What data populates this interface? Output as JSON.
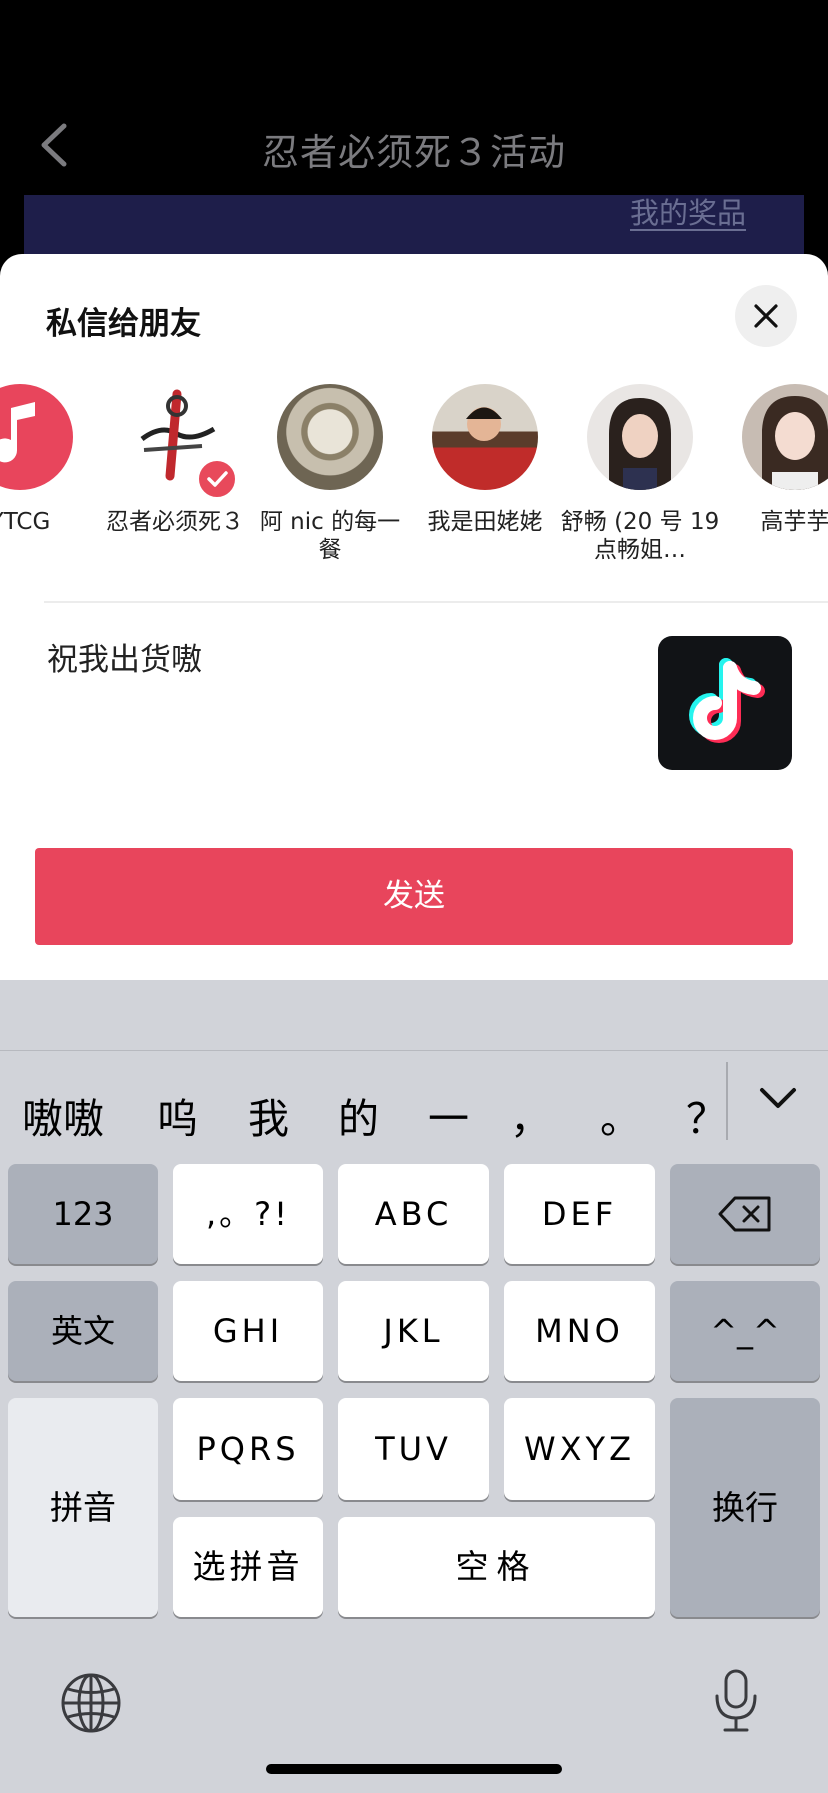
{
  "nav": {
    "title": "忍者必须死３活动",
    "prizes_link": "我的奖品"
  },
  "sheet": {
    "title": "私信给朋友",
    "friends": [
      {
        "name": "YTCG"
      },
      {
        "name": "忍者必须死３",
        "selected": true
      },
      {
        "name": "阿 nic 的每一餐"
      },
      {
        "name": "我是田姥姥"
      },
      {
        "name": "舒畅 (20 号 19点畅姐…"
      },
      {
        "name": "高芋芋"
      }
    ],
    "message": "祝我出货嗷",
    "send_label": "发送"
  },
  "keyboard": {
    "candidates": [
      "嗷嗷",
      "呜",
      "我",
      "的",
      "一",
      "，",
      "。",
      "？"
    ],
    "keys": {
      "num": "123",
      "punct": ",。?!",
      "abc": "ABC",
      "def": "DEF",
      "english": "英文",
      "ghi": "GHI",
      "jkl": "JKL",
      "mno": "MNO",
      "emoji": "^_^",
      "pinyin": "拼音",
      "pqrs": "PQRS",
      "tuv": "TUV",
      "wxyz": "WXYZ",
      "return": "换行",
      "select_pinyin": "选拼音",
      "space": "空格"
    }
  },
  "colors": {
    "accent": "#e8455c",
    "sheet_bg": "#ffffff",
    "keyboard_bg": "#d1d3d9"
  }
}
